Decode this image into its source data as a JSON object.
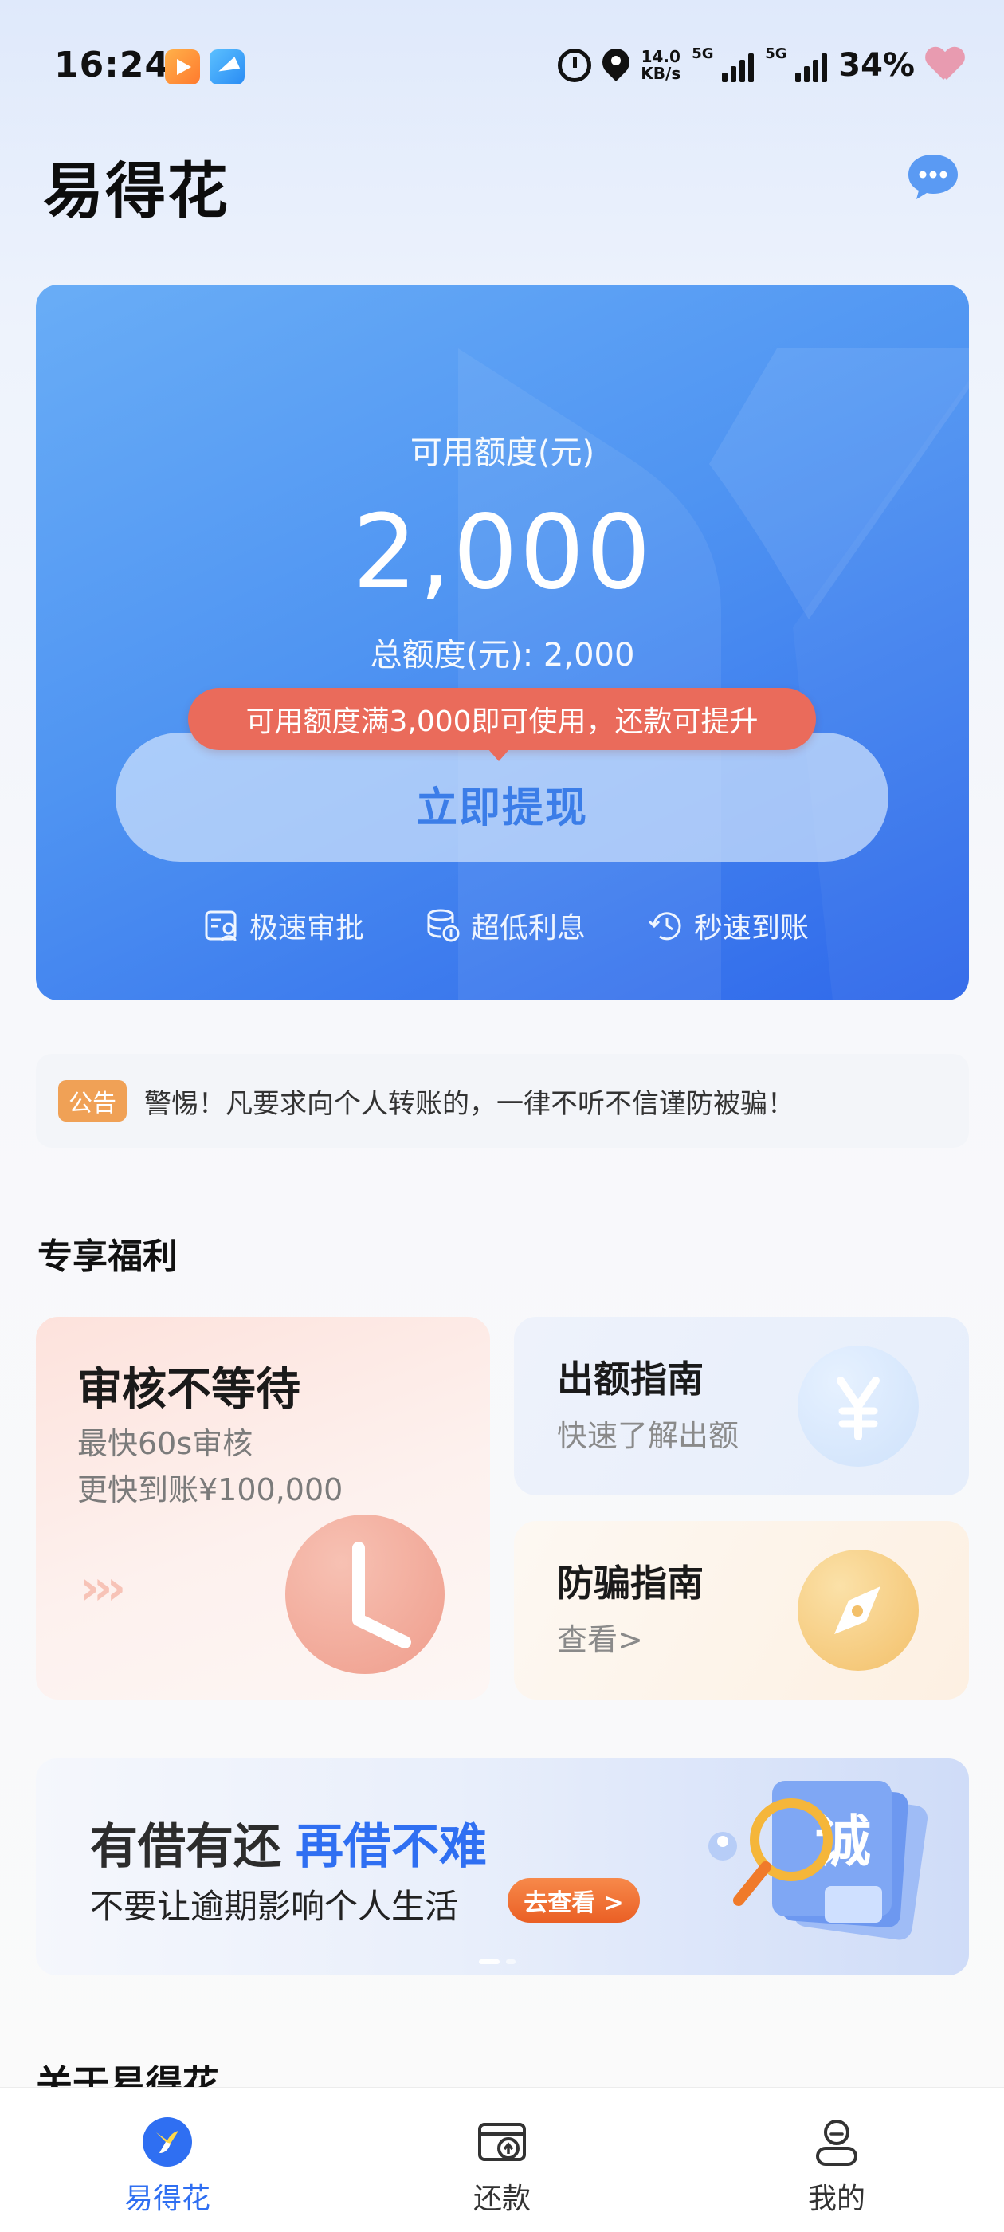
{
  "status_bar": {
    "time": "16:24",
    "speed_top": "14.0",
    "speed_bottom": "KB/s",
    "signal1": "5G",
    "signal2": "5G",
    "battery": "34%",
    "icons": [
      "video-app-icon",
      "telegram-app-icon",
      "alarm-icon",
      "location-icon",
      "heart-icon"
    ]
  },
  "header": {
    "title": "易得花",
    "chat_icon": "customer-service-chat-icon"
  },
  "credit_card": {
    "label": "可用额度(元)",
    "amount": "2,000",
    "total": "总额度(元): 2,000",
    "tip": "可用额度满3,000即可使用，还款可提升",
    "button": "立即提现",
    "features": [
      {
        "label": "极速审批",
        "icon": "approval-icon"
      },
      {
        "label": "超低利息",
        "icon": "coins-icon"
      },
      {
        "label": "秒速到账",
        "icon": "clock-arrow-icon"
      }
    ]
  },
  "notice": {
    "tag": "公告",
    "text": "警惕！凡要求向个人转账的，一律不听不信谨防被骗！"
  },
  "benefits": {
    "title": "专享福利",
    "big": {
      "title": "审核不等待",
      "line1": "最快60s审核",
      "line2": "更快到账¥100,000",
      "arrows": "›››",
      "icon": "clock-icon"
    },
    "cards": [
      {
        "title": "出额指南",
        "sub": "快速了解出额",
        "icon": "yen-icon"
      },
      {
        "title": "防骗指南",
        "sub": "查看>",
        "icon": "compass-icon"
      }
    ]
  },
  "banner": {
    "title_a": "有借有还",
    "title_b": "再借不难",
    "sub": "不要让逾期影响个人生活",
    "button": "去查看 >",
    "art_text": "诚",
    "active_slide": 1,
    "slide_count": 2
  },
  "about": {
    "title": "关于易得花"
  },
  "bottom_nav": {
    "items": [
      {
        "label": "易得花",
        "icon": "home-logo-icon",
        "active": true
      },
      {
        "label": "还款",
        "icon": "repay-icon",
        "active": false
      },
      {
        "label": "我的",
        "icon": "profile-icon",
        "active": false
      }
    ]
  },
  "colors": {
    "brand_blue": "#2f6ff2",
    "tip_red": "#ea6b5b",
    "notice_orange": "#f0a156",
    "banner_orange": "#ea5f25"
  }
}
